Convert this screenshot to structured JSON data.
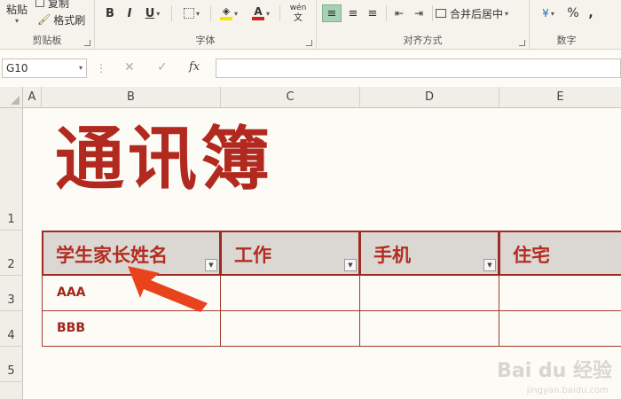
{
  "ribbon": {
    "clipboard": {
      "paste": "粘贴",
      "copy": "复制",
      "format_painter": "格式刷",
      "label": "剪贴板"
    },
    "font": {
      "bold": "B",
      "italic": "I",
      "underline": "U",
      "wen": "wén",
      "wen_sub": "文",
      "label": "字体"
    },
    "alignment": {
      "merge_center": "合并后居中",
      "label": "对齐方式"
    },
    "number": {
      "percent": "%",
      "comma": ",",
      "label": "数字"
    }
  },
  "formula_bar": {
    "name_box": "G10",
    "fx": "fx"
  },
  "columns": [
    "A",
    "B",
    "C",
    "D",
    "E"
  ],
  "rows": [
    "1",
    "2",
    "3",
    "4",
    "5"
  ],
  "sheet": {
    "title": "通讯簿",
    "headers": [
      "学生家长姓名",
      "工作",
      "手机",
      "住宅"
    ],
    "data": [
      [
        "AAA",
        "",
        "",
        ""
      ],
      [
        "BBB",
        "",
        "",
        ""
      ]
    ]
  },
  "watermark": {
    "brand": "Bai du 经验",
    "url": "jingyan.baidu.com"
  },
  "colors": {
    "accent": "#b22a1f",
    "header_fill": "#dbd8d3",
    "arrow": "#e8431c"
  }
}
